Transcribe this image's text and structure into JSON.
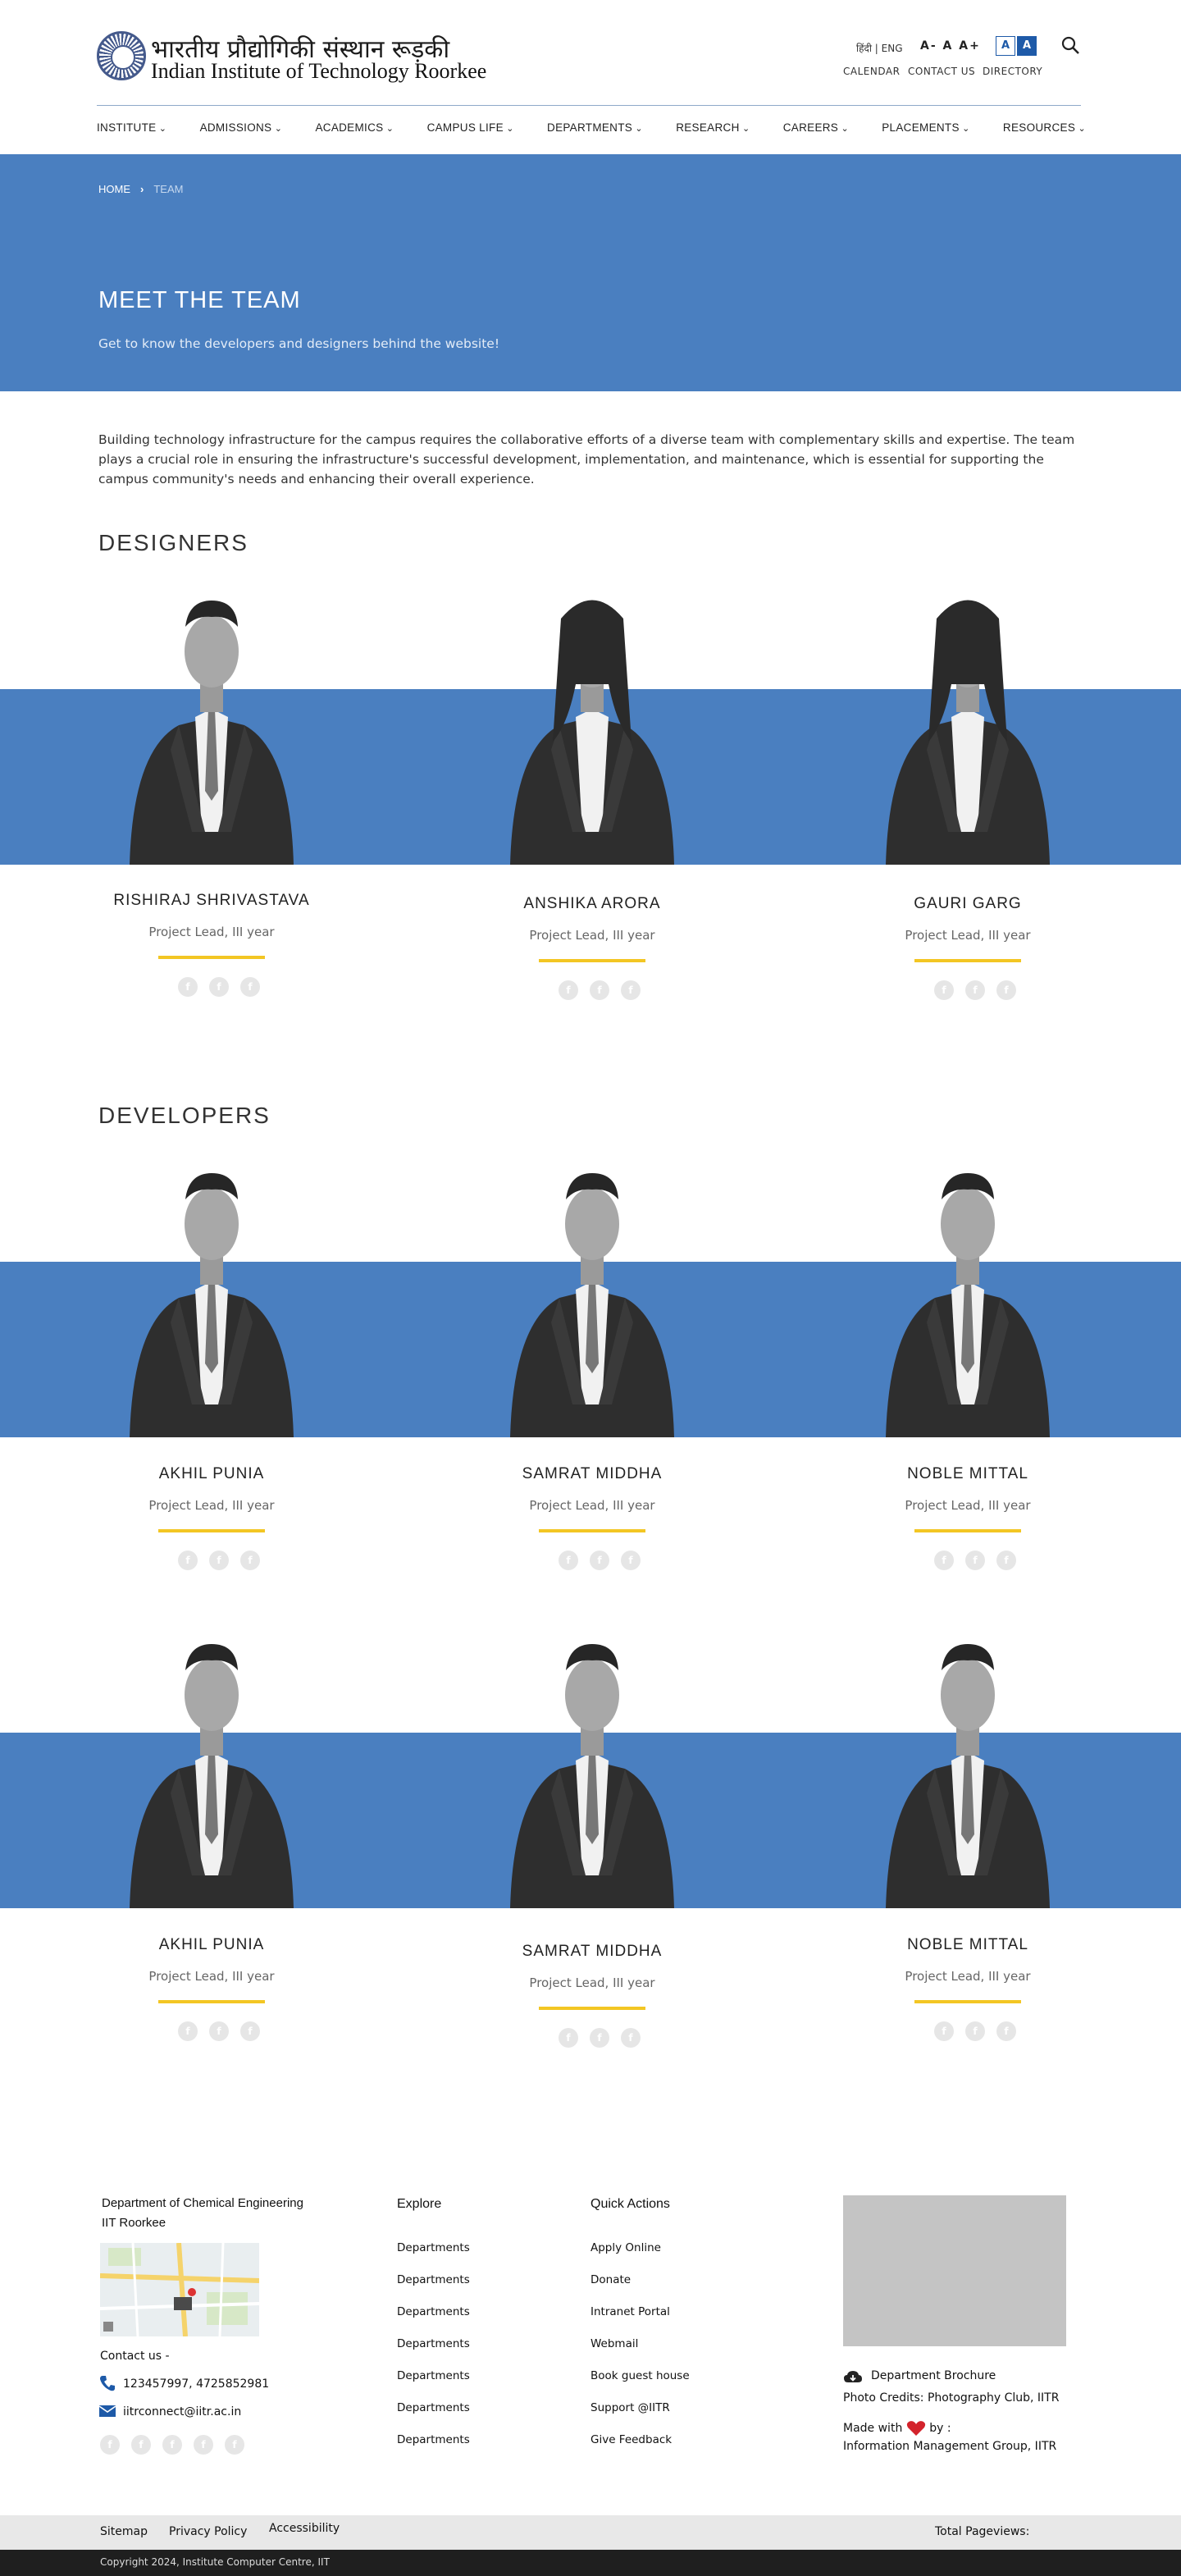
{
  "header": {
    "logo_hindi": "भारतीय प्रौद्योगिकी संस्थान रूड़की",
    "logo_english": "Indian Institute of Technology Roorkee",
    "lang_toggle": "हिंदी | ENG",
    "font_sizes": "A- A A+",
    "contrast_light": "A",
    "contrast_dark": "A",
    "top_links": [
      "CALENDAR",
      "CONTACT US",
      "DIRECTORY"
    ],
    "search_icon": "search-icon"
  },
  "nav": [
    "INSTITUTE",
    "ADMISSIONS",
    "ACADEMICS",
    "CAMPUS LIFE",
    "DEPARTMENTS",
    "RESEARCH",
    "CAREERS",
    "PLACEMENTS",
    "RESOURCES"
  ],
  "hero": {
    "breadcrumb_home": "HOME",
    "breadcrumb_current": "TEAM",
    "title": "MEET THE TEAM",
    "subtitle": "Get to know the developers and designers behind the website!"
  },
  "intro": "Building technology infrastructure for the campus requires the collaborative efforts of a diverse team with complementary skills and expertise. The team plays a crucial role in ensuring the infrastructure's successful development, implementation, and maintenance, which is essential for supporting the campus community's needs and enhancing their overall experience.",
  "designers": {
    "title": "DESIGNERS",
    "members": [
      {
        "name": "RISHIRAJ SHRIVASTAVA",
        "role": "Project Lead, III year"
      },
      {
        "name": "ANSHIKA ARORA",
        "role": "Project Lead, III year"
      },
      {
        "name": "GAURI GARG",
        "role": "Project Lead, III year"
      }
    ]
  },
  "developers": {
    "title": "DEVELOPERS",
    "rows": [
      [
        {
          "name": "AKHIL PUNIA",
          "role": "Project Lead, III year"
        },
        {
          "name": "SAMRAT MIDDHA",
          "role": "Project Lead, III year"
        },
        {
          "name": "NOBLE MITTAL",
          "role": "Project Lead, III year"
        }
      ],
      [
        {
          "name": "AKHIL PUNIA",
          "role": "Project Lead, III year"
        },
        {
          "name": "SAMRAT MIDDHA",
          "role": "Project Lead, III year"
        },
        {
          "name": "NOBLE MITTAL",
          "role": "Project Lead, III year"
        }
      ]
    ]
  },
  "footer": {
    "dept_line1": "Department of Chemical Engineering",
    "dept_line2": "IIT Roorkee",
    "contact_label": "Contact us -",
    "phone": "123457997, 4725852981",
    "email": "iitrconnect@iitr.ac.in",
    "explore_title": "Explore",
    "explore_links": [
      "Departments",
      "Departments",
      "Departments",
      "Departments",
      "Departments",
      "Departments",
      "Departments"
    ],
    "quick_title": "Quick Actions",
    "quick_links": [
      "Apply Online",
      "Donate",
      "Intranet Portal",
      "Webmail",
      "Book guest house",
      "Support @IITR",
      "Give Feedback"
    ],
    "brochure": "Department Brochure",
    "photo_credits": "Photo Credits: Photography Club, IITR",
    "made_with": "Made with",
    "made_by": "by :",
    "made_group": "Information Management Group, IITR",
    "bottom_links": [
      "Sitemap",
      "Privacy Policy",
      "Accessibility"
    ],
    "pageviews": "Total Pageviews:",
    "copyright": "Copyright 2024, Institute Computer Centre, IIT"
  },
  "colors": {
    "band": "#4a7fc0",
    "accent": "#f3c623",
    "brand": "#1e5aa8"
  }
}
